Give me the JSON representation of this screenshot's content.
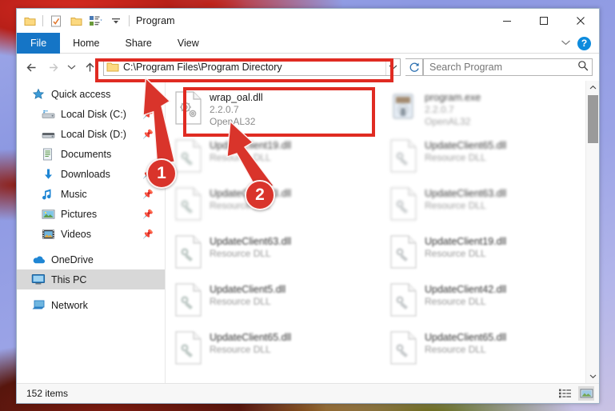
{
  "window": {
    "title": "Program",
    "quick_access_icons": [
      "folder-icon",
      "properties-icon",
      "new-folder-icon",
      "customize-menu-icon",
      "dropdown-icon"
    ],
    "controls": {
      "minimize": "—",
      "maximize": "☐",
      "close": "✕"
    }
  },
  "ribbon": {
    "tabs": [
      {
        "label": "File",
        "active": true
      },
      {
        "label": "Home",
        "active": false
      },
      {
        "label": "Share",
        "active": false
      },
      {
        "label": "View",
        "active": false
      }
    ],
    "collapse_icon": "chevron-down-icon",
    "help_label": "?"
  },
  "addressbar": {
    "back_icon": "arrow-left-icon",
    "forward_icon": "arrow-right-icon",
    "recent_icon": "chevron-down-icon",
    "up_icon": "arrow-up-icon",
    "path": "C:\\Program Files\\Program Directory",
    "dropdown_icon": "chevron-down-icon",
    "refresh_icon": "refresh-icon",
    "highlight_color": "#e02b22"
  },
  "search": {
    "placeholder": "Search Program",
    "value": "",
    "icon": "search-icon"
  },
  "sidebar": {
    "items": [
      {
        "label": "Quick access",
        "icon": "star-icon",
        "indent": false,
        "pinned": false,
        "selected": false
      },
      {
        "label": "Local Disk (C:)",
        "icon": "drive-icon",
        "indent": true,
        "pinned": true,
        "selected": false
      },
      {
        "label": "Local Disk (D:)",
        "icon": "drive-icon",
        "indent": true,
        "pinned": true,
        "selected": false
      },
      {
        "label": "Documents",
        "icon": "documents-icon",
        "indent": true,
        "pinned": false,
        "selected": false
      },
      {
        "label": "Downloads",
        "icon": "downloads-icon",
        "indent": true,
        "pinned": true,
        "selected": false
      },
      {
        "label": "Music",
        "icon": "music-icon",
        "indent": true,
        "pinned": true,
        "selected": false
      },
      {
        "label": "Pictures",
        "icon": "pictures-icon",
        "indent": true,
        "pinned": true,
        "selected": false
      },
      {
        "label": "Videos",
        "icon": "videos-icon",
        "indent": true,
        "pinned": true,
        "selected": false
      },
      {
        "label": "OneDrive",
        "icon": "onedrive-icon",
        "indent": false,
        "pinned": false,
        "selected": false
      },
      {
        "label": "This PC",
        "icon": "thispc-icon",
        "indent": false,
        "pinned": false,
        "selected": true
      },
      {
        "label": "Network",
        "icon": "network-icon",
        "indent": false,
        "pinned": false,
        "selected": false
      }
    ]
  },
  "files": [
    {
      "name": "wrap_oal.dll",
      "line2": "2.2.0.7",
      "line3": "OpenAL32",
      "icon": "dll-gears-icon",
      "focus": true,
      "blur": "none"
    },
    {
      "name": "program.exe",
      "line2": "2.2.0.7",
      "line3": "OpenAL32",
      "icon": "exe-icon",
      "focus": false,
      "blur": "b2"
    },
    {
      "name": "UpdateClient19.dll",
      "line2": "Resource DLL",
      "line3": "",
      "icon": "dll-icon",
      "focus": false,
      "blur": "b1"
    },
    {
      "name": "UpdateClient65.dll",
      "line2": "Resource DLL",
      "line3": "",
      "icon": "dll-icon",
      "focus": false,
      "blur": "b1"
    },
    {
      "name": "UpdateClient63.dll",
      "line2": "Resource DLL",
      "line3": "",
      "icon": "dll-icon",
      "focus": false,
      "blur": "b1"
    },
    {
      "name": "UpdateClient63.dll",
      "line2": "Resource DLL",
      "line3": "",
      "icon": "dll-icon",
      "focus": false,
      "blur": "b1"
    },
    {
      "name": "UpdateClient63.dll",
      "line2": "Resource DLL",
      "line3": "",
      "icon": "dll-icon",
      "focus": false,
      "blur": "b3"
    },
    {
      "name": "UpdateClient19.dll",
      "line2": "Resource DLL",
      "line3": "",
      "icon": "dll-icon",
      "focus": false,
      "blur": "b3"
    },
    {
      "name": "UpdateClient5.dll",
      "line2": "Resource DLL",
      "line3": "",
      "icon": "dll-icon",
      "focus": false,
      "blur": "b3"
    },
    {
      "name": "UpdateClient42.dll",
      "line2": "Resource DLL",
      "line3": "",
      "icon": "dll-icon",
      "focus": false,
      "blur": "b3"
    },
    {
      "name": "UpdateClient65.dll",
      "line2": "Resource DLL",
      "line3": "",
      "icon": "dll-icon",
      "focus": false,
      "blur": "b3"
    },
    {
      "name": "UpdateClient65.dll",
      "line2": "Resource DLL",
      "line3": "",
      "icon": "dll-icon",
      "focus": false,
      "blur": "b3"
    }
  ],
  "statusbar": {
    "item_count": "152 items",
    "view_details_icon": "details-view-icon",
    "view_tiles_icon": "tiles-view-icon"
  },
  "scrollbar": {
    "up_icon": "chevron-up-icon",
    "down_icon": "chevron-down-icon"
  },
  "annotations": {
    "marker1": "1",
    "marker2": "2",
    "accent": "#d9342b"
  }
}
